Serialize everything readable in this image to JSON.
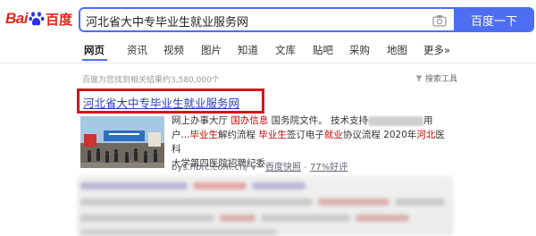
{
  "header": {
    "logo_text_bai": "Bai",
    "logo_text_du": "百度",
    "search_value": "河北省大中专毕业生就业服务网",
    "search_button_label": "百度一下",
    "camera_icon": "camera-icon"
  },
  "tabs": [
    {
      "label": "网页",
      "active": true
    },
    {
      "label": "资讯"
    },
    {
      "label": "视频"
    },
    {
      "label": "图片"
    },
    {
      "label": "知道"
    },
    {
      "label": "文库"
    },
    {
      "label": "贴吧"
    },
    {
      "label": "采购"
    },
    {
      "label": "地图"
    },
    {
      "label": "更多»"
    }
  ],
  "results_info": {
    "count_text": "百度为您找到相关结果约3,580,000个",
    "tools_label": "搜索工具"
  },
  "result": {
    "title": "河北省大中专毕业生就业服务网",
    "abstract_line1_a": "网上办事大厅 ",
    "abstract_line1_hl1": "国办信息",
    "abstract_line1_b": " 国务院文件。 技术支持",
    "abstract_line1_c": "用",
    "abstract_line2_a": "户...",
    "abstract_line2_hl1": "毕业生",
    "abstract_line2_b": "解约流程 ",
    "abstract_line2_hl2": "毕业生",
    "abstract_line2_c": "签订电子",
    "abstract_line2_hl3": "就业",
    "abstract_line2_d": "协议流程 2020年",
    "abstract_line2_hl4": "河北",
    "abstract_line2_e": "医科",
    "abstract_line3": "大学第四医院招聘纪委...",
    "url": "bys.hbrc.com.cn/",
    "snapshot": "百度快照",
    "rating": "77%好评"
  },
  "colors": {
    "brand_blue": "#4e6ef2",
    "logo_red": "#e1251b",
    "highlight_red": "#c00000",
    "link_blue": "#2440b3",
    "annotation_red": "#d4141b"
  }
}
